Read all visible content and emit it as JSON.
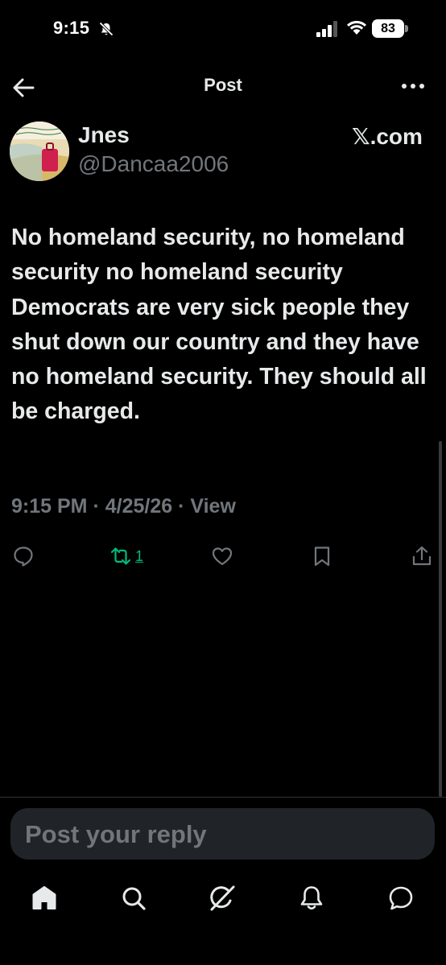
{
  "status_bar": {
    "time": "9:15",
    "battery": "83"
  },
  "header": {
    "title": "Post"
  },
  "post": {
    "author": {
      "display_name": "Jnes",
      "handle": "@Dancaa2006"
    },
    "source_logo": "𝕏",
    "source_suffix": ".com",
    "text": "No homeland security, no homeland security no homeland security Democrats are very sick people they shut down our country and they have no homeland security. They should all be charged.",
    "time": "9:15 PM",
    "date": "4/25/26",
    "views_label": "View",
    "meta_separator": "·"
  },
  "actions": {
    "reply_icon": "comment-icon",
    "retweet_icon": "repost-icon",
    "retweet_count": "1",
    "like_icon": "heart-icon",
    "bookmark_icon": "bookmark-icon",
    "share_icon": "share-icon"
  },
  "reply_box": {
    "placeholder": "Post your reply"
  },
  "bottom_nav": {
    "items": [
      "home-icon",
      "search-icon",
      "grok-icon",
      "notifications-icon",
      "messages-icon"
    ]
  },
  "colors": {
    "background": "#000000",
    "text": "#e7e9ea",
    "secondary": "#71767b",
    "retweet_active": "#00ba7c",
    "reply_box": "#202327"
  }
}
